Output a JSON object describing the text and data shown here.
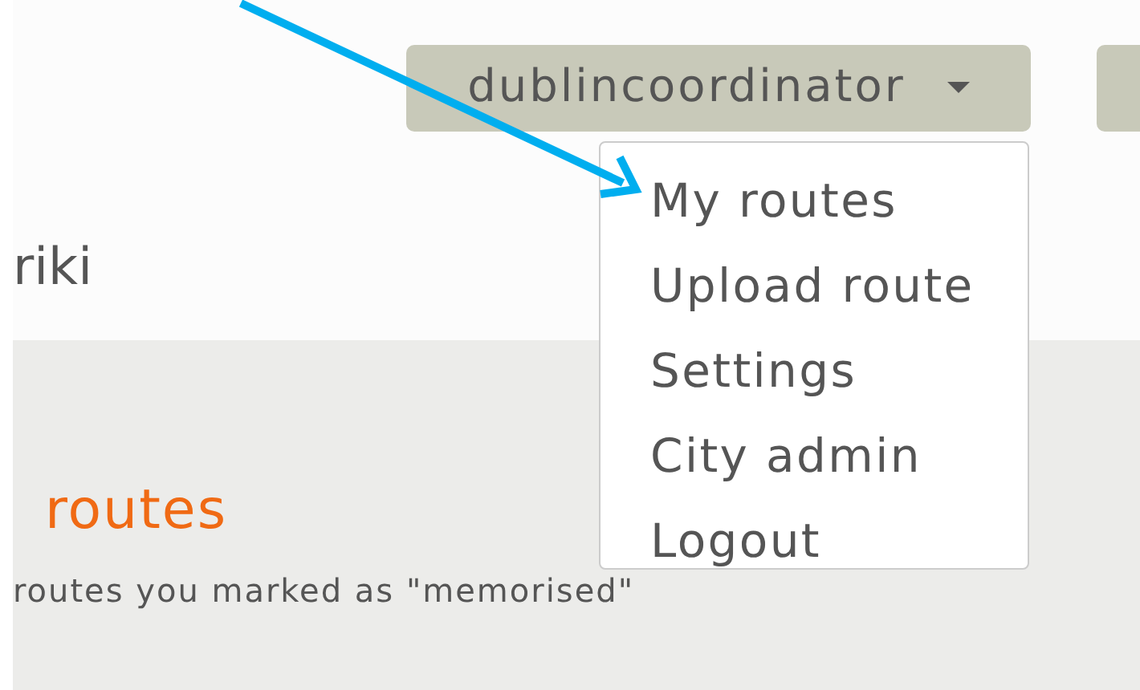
{
  "header": {
    "title_fragment": "riki",
    "user_menu": {
      "label": "dublincoordinator",
      "items": [
        {
          "label": "My routes"
        },
        {
          "label": "Upload route"
        },
        {
          "label": "Settings"
        },
        {
          "label": "City admin"
        },
        {
          "label": "Logout"
        }
      ]
    }
  },
  "section": {
    "heading": "routes",
    "description": "routes you marked as \"memorised\""
  }
}
